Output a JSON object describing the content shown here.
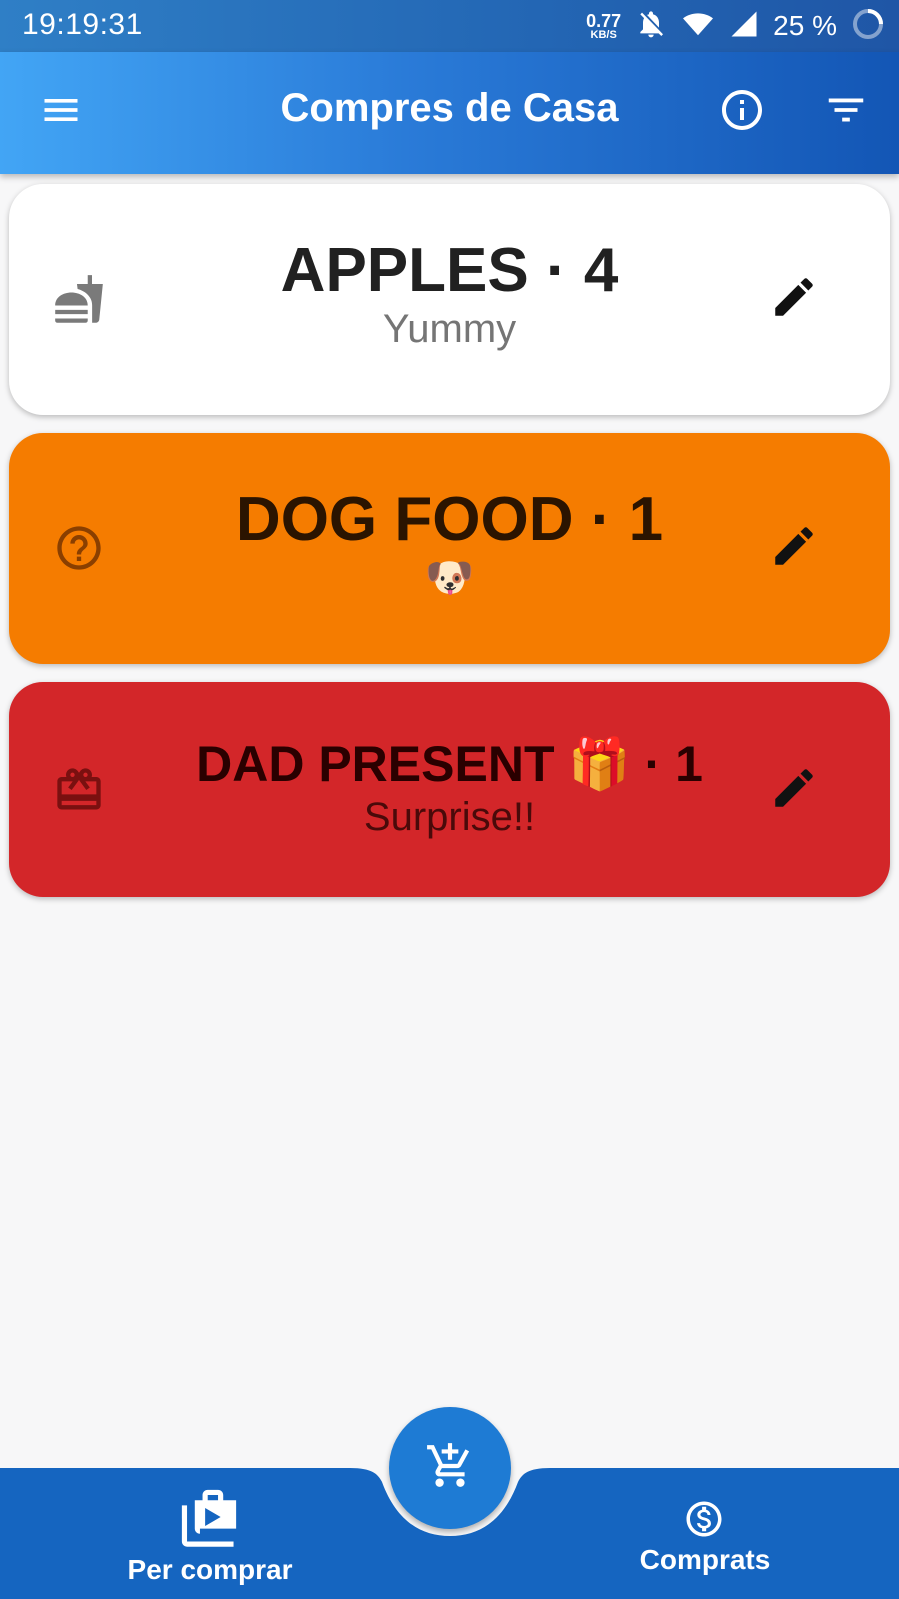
{
  "status_bar": {
    "time": "19:19:31",
    "net_speed_value": "0.77",
    "net_speed_unit": "KB/S",
    "battery": "25 %"
  },
  "app_bar": {
    "title": "Compres de Casa",
    "icons": [
      "menu-icon",
      "info-icon",
      "filter-icon"
    ]
  },
  "items": [
    {
      "title": "APPLES · 4",
      "subtitle": "Yummy",
      "icon": "fastfood-icon",
      "bg_color": "#ffffff",
      "text_color": "#212121",
      "sub_color": "#757575"
    },
    {
      "title": "DOG FOOD · 1",
      "subtitle": "🐶",
      "icon": "help-circle-icon",
      "bg_color": "#f57c00",
      "text_color": "#2b1400",
      "sub_color": "#2b1400"
    },
    {
      "title": "DAD PRESENT 🎁 · 1",
      "subtitle": "Surprise!!",
      "icon": "gift-card-icon",
      "bg_color": "#d32629",
      "text_color": "#2a0000",
      "sub_color": "#4a0a0a"
    }
  ],
  "bottom_nav": {
    "left_label": "Per comprar",
    "right_label": "Comprats",
    "fab_icon": "add-to-cart-icon",
    "bar_color": "#1565c0"
  }
}
